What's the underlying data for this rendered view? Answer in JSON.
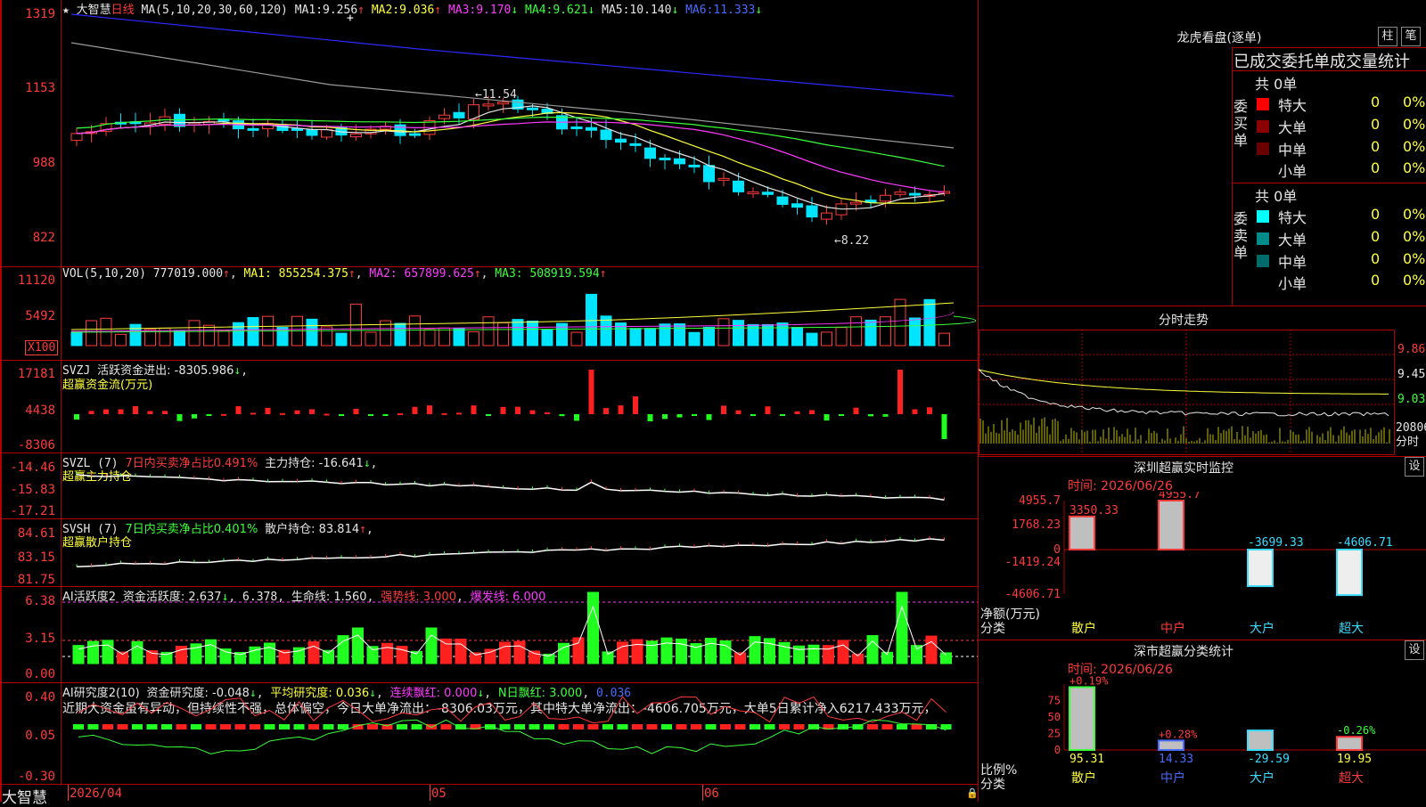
{
  "stock": {
    "name": "大智慧",
    "period": "日线"
  },
  "price_panel": {
    "ma_params": "MA(5,10,20,30,60,120)",
    "ma1_label": "MA1:",
    "ma1_val": "9.256",
    "ma1_arrow": "↑",
    "ma2_label": "MA2:",
    "ma2_val": "9.036",
    "ma2_arrow": "↑",
    "ma3_label": "MA3:",
    "ma3_val": "9.170",
    "ma3_arrow": "↓",
    "ma4_label": "MA4:",
    "ma4_val": "9.621",
    "ma4_arrow": "↓",
    "ma5_label": "MA5:",
    "ma5_val": "10.140",
    "ma5_arrow": "↓",
    "ma6_label": "MA6:",
    "ma6_val": "11.333",
    "ma6_arrow": "↓",
    "ticks": [
      "1319",
      "1153",
      "988",
      "822"
    ],
    "high_label": "←11.54",
    "low_label": "←8.22"
  },
  "vol_panel": {
    "params": "VOL(5,10,20)",
    "vol": "777019.000",
    "ma1": "MA1: 855254.375",
    "ma2": "MA2: 657899.625",
    "ma3": "MA3: 508919.594",
    "ticks": [
      "11120",
      "5492"
    ],
    "unit": "X100"
  },
  "svzj_panel": {
    "name": "SVZJ",
    "label": "活跃资金进出: -8305.986",
    "arrow": "↓",
    "subtitle": "超赢资金流(万元)",
    "ticks": [
      "17181",
      "4438",
      "-8306"
    ]
  },
  "svzl_panel": {
    "name": "SVZL (7)",
    "ratio": "7日内买卖净占比0.491%",
    "holding": "主力持仓: -16.641",
    "arrow": "↓",
    "subtitle": "超赢主力持仓",
    "ticks": [
      "-14.46",
      "-15.83",
      "-17.21"
    ]
  },
  "svsh_panel": {
    "name": "SVSH (7)",
    "ratio": "7日内买卖净占比0.401%",
    "holding": "散户持仓: 83.814",
    "arrow": "↑",
    "subtitle": "超赢散户持仓",
    "ticks": [
      "84.61",
      "83.15",
      "81.75"
    ]
  },
  "ai_active_panel": {
    "name": "AI活跃度2",
    "activity": "资金活跃度: 2.637",
    "activity_arrow": "↓",
    "val2": "6.378",
    "lifeline": "生命线: 1.560",
    "strong": "强势线: 3.000",
    "burst": "爆发线: 6.000",
    "ticks": [
      "6.38",
      "3.15",
      "0.00"
    ]
  },
  "ai_research_panel": {
    "name": "AI研究度2(10)",
    "research": "资金研究度: -0.048",
    "research_arrow": "↓",
    "avg": "平均研究度: 0.036",
    "avg_arrow": "↓",
    "cont": "连续飘红: 0.000",
    "cont_arrow": "↓",
    "nday": "N日飘红: 3.000",
    "tail": "0.036",
    "commentary": "近期大资金虽有异动，但持续性不强，总体偏空，今日大单净流出：-8306.03万元，其中特大单净流出：-4606.705万元，大单5日累计净入6217.433万元，",
    "ticks": [
      "0.40",
      "0.05",
      "-0.30"
    ]
  },
  "date_axis": {
    "start": "2026/04",
    "m5": "05",
    "m6": "06",
    "name": "大智慧"
  },
  "right": {
    "dragon_title": "龙虎看盘(逐单)",
    "btn_zhu": "柱",
    "btn_bi": "笔",
    "order_title": "已成交委托单成交量统计",
    "buy_header": "共 0单",
    "buy_side": "委买单",
    "sell_header": "共 0单",
    "sell_side": "委卖单",
    "rows": [
      {
        "label": "特大",
        "count": "0",
        "pct": "0%"
      },
      {
        "label": "大单",
        "count": "0",
        "pct": "0%"
      },
      {
        "label": "中单",
        "count": "0",
        "pct": "0%"
      },
      {
        "label": "小单",
        "count": "0",
        "pct": "0%"
      }
    ],
    "sell_rows": [
      {
        "label": "特大",
        "count": "0",
        "pct": "0%"
      },
      {
        "label": "大单",
        "count": "0",
        "pct": "0%"
      },
      {
        "label": "中单",
        "count": "0",
        "pct": "0%"
      },
      {
        "label": "小单",
        "count": "0",
        "pct": "0%"
      }
    ],
    "intraday_title": "分时走势",
    "intraday_ticks": [
      "9.86",
      "9.45",
      "9.03",
      "20806",
      "分时"
    ],
    "sz_title": "深圳超赢实时监控",
    "sz_btn": "设",
    "sz_time": "时间: 2026/06/26",
    "sz_ticks": [
      "4955.7",
      "1768.23",
      "0",
      "-1419.24",
      "-4606.71"
    ],
    "sz_bars": [
      {
        "label": "散户",
        "value": "3350.33"
      },
      {
        "label": "中户",
        "value": "4955.7"
      },
      {
        "label": "大户",
        "value": "-3699.33"
      },
      {
        "label": "超大",
        "value": "-4606.71"
      }
    ],
    "sz_ylabel1": "净额(万元)",
    "sz_ylabel2": "分类",
    "cls_title": "深市超赢分类统计",
    "cls_btn": "设",
    "cls_time": "时间: 2026/06/26",
    "cls_ticks": [
      "75",
      "50",
      "25",
      "0"
    ],
    "cls_bars": [
      {
        "label": "散户",
        "pct": "+0.19%",
        "value": "95.31"
      },
      {
        "label": "中户",
        "pct": "+0.28%",
        "value": "14.33"
      },
      {
        "label": "大户",
        "pct": "",
        "value": "-29.59"
      },
      {
        "label": "超大",
        "pct": "-0.26%",
        "value": "19.95"
      }
    ],
    "cls_ylabel1": "比例%",
    "cls_ylabel2": "分类"
  },
  "colors": {
    "up": "#ff3b3b",
    "down": "#00e5ff",
    "grid": "#b00000",
    "ma1": "#e6e6e6",
    "ma2": "#ffff3b",
    "ma3": "#ff3bff",
    "ma4": "#3bff3b",
    "ma5": "#9a9a9a",
    "ma6": "#2a2aff"
  }
}
